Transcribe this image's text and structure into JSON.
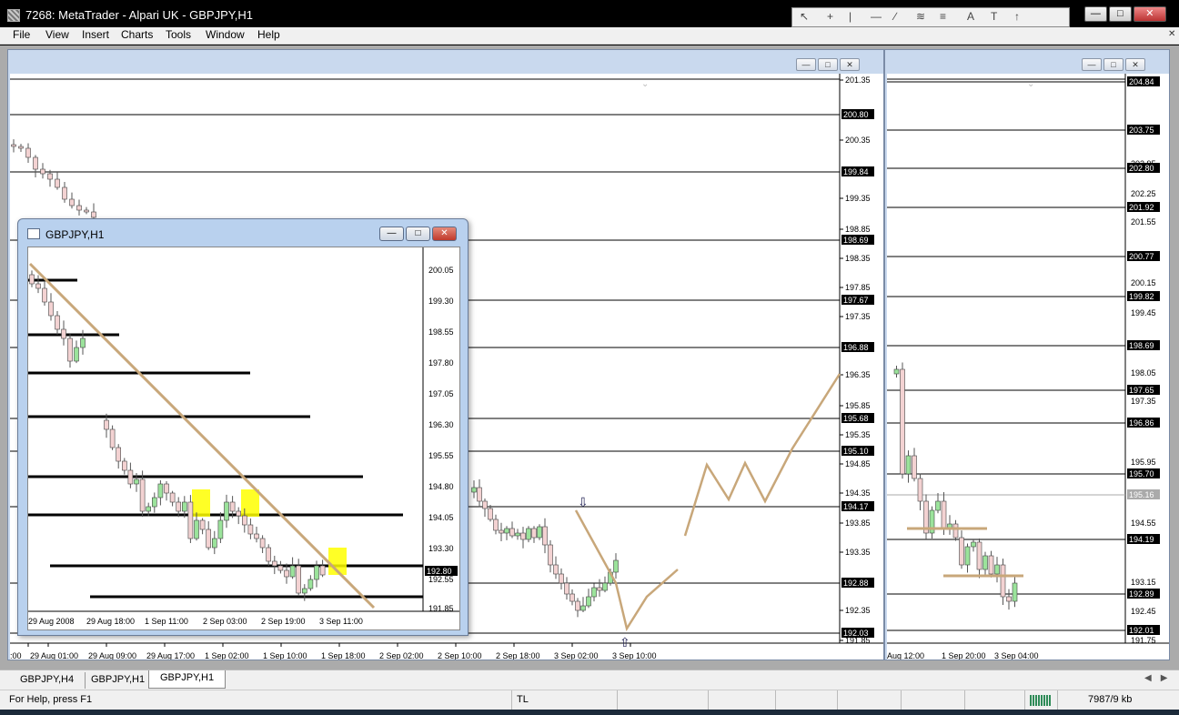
{
  "app": {
    "title": "7268: MetaTrader - Alpari UK - GBPJPY,H1"
  },
  "menu": [
    "File",
    "View",
    "Insert",
    "Charts",
    "Tools",
    "Window",
    "Help"
  ],
  "main_chart": {
    "price_labels": [
      "201.35",
      "200.35",
      "199.35",
      "198.85",
      "198.35",
      "197.85",
      "197.35",
      "196.35",
      "195.85",
      "195.35",
      "194.85",
      "194.35",
      "193.85",
      "193.35",
      "192.35",
      "191.85"
    ],
    "level_labels": [
      "200.80",
      "199.84",
      "198.69",
      "197.67",
      "196.88",
      "195.68",
      "195.10",
      "194.17",
      "192.88",
      "192.03"
    ],
    "time_labels": [
      ":00",
      "29 Aug 01:00",
      "29 Aug 09:00",
      "29 Aug 17:00",
      "1 Sep 02:00",
      "1 Sep 10:00",
      "1 Sep 18:00",
      "2 Sep 02:00",
      "2 Sep 10:00",
      "2 Sep 18:00",
      "3 Sep 02:00",
      "3 Sep 10:00"
    ],
    "colors": {
      "line": "#000000",
      "trend": "#c8a77a",
      "bull": "#9be39b",
      "bear": "#f3d2d2"
    }
  },
  "right_chart": {
    "price_labels": [
      "202.95",
      "202.25",
      "201.55",
      "200.15",
      "199.45",
      "198.05",
      "197.35",
      "195.95",
      "195.16",
      "194.55",
      "193.15",
      "192.45",
      "191.75"
    ],
    "level_labels": [
      "204.84",
      "203.75",
      "202.80",
      "201.92",
      "200.77",
      "199.82",
      "198.69",
      "197.65",
      "196.86",
      "195.70",
      "194.19",
      "192.89",
      "192.01"
    ],
    "time_labels": [
      "Aug 12:00",
      "1 Sep 20:00",
      "3 Sep 04:00"
    ]
  },
  "float_window": {
    "title": "GBPJPY,H1",
    "price_labels": [
      "200.05",
      "199.30",
      "198.55",
      "197.80",
      "197.05",
      "196.30",
      "195.55",
      "194.80",
      "194.05",
      "193.30",
      "192.55",
      "191.85"
    ],
    "current_price": "192.80",
    "time_labels": [
      "29 Aug 2008",
      "29 Aug 18:00",
      "1 Sep 11:00",
      "2 Sep 03:00",
      "2 Sep 19:00",
      "3 Sep 11:00"
    ]
  },
  "tabs": [
    "GBPJPY,H4",
    "GBPJPY,H1",
    "GBPJPY,H1"
  ],
  "active_tab": 2,
  "status": {
    "help": "For Help, press F1",
    "mode": "TL",
    "traffic": "7987/9 kb"
  }
}
